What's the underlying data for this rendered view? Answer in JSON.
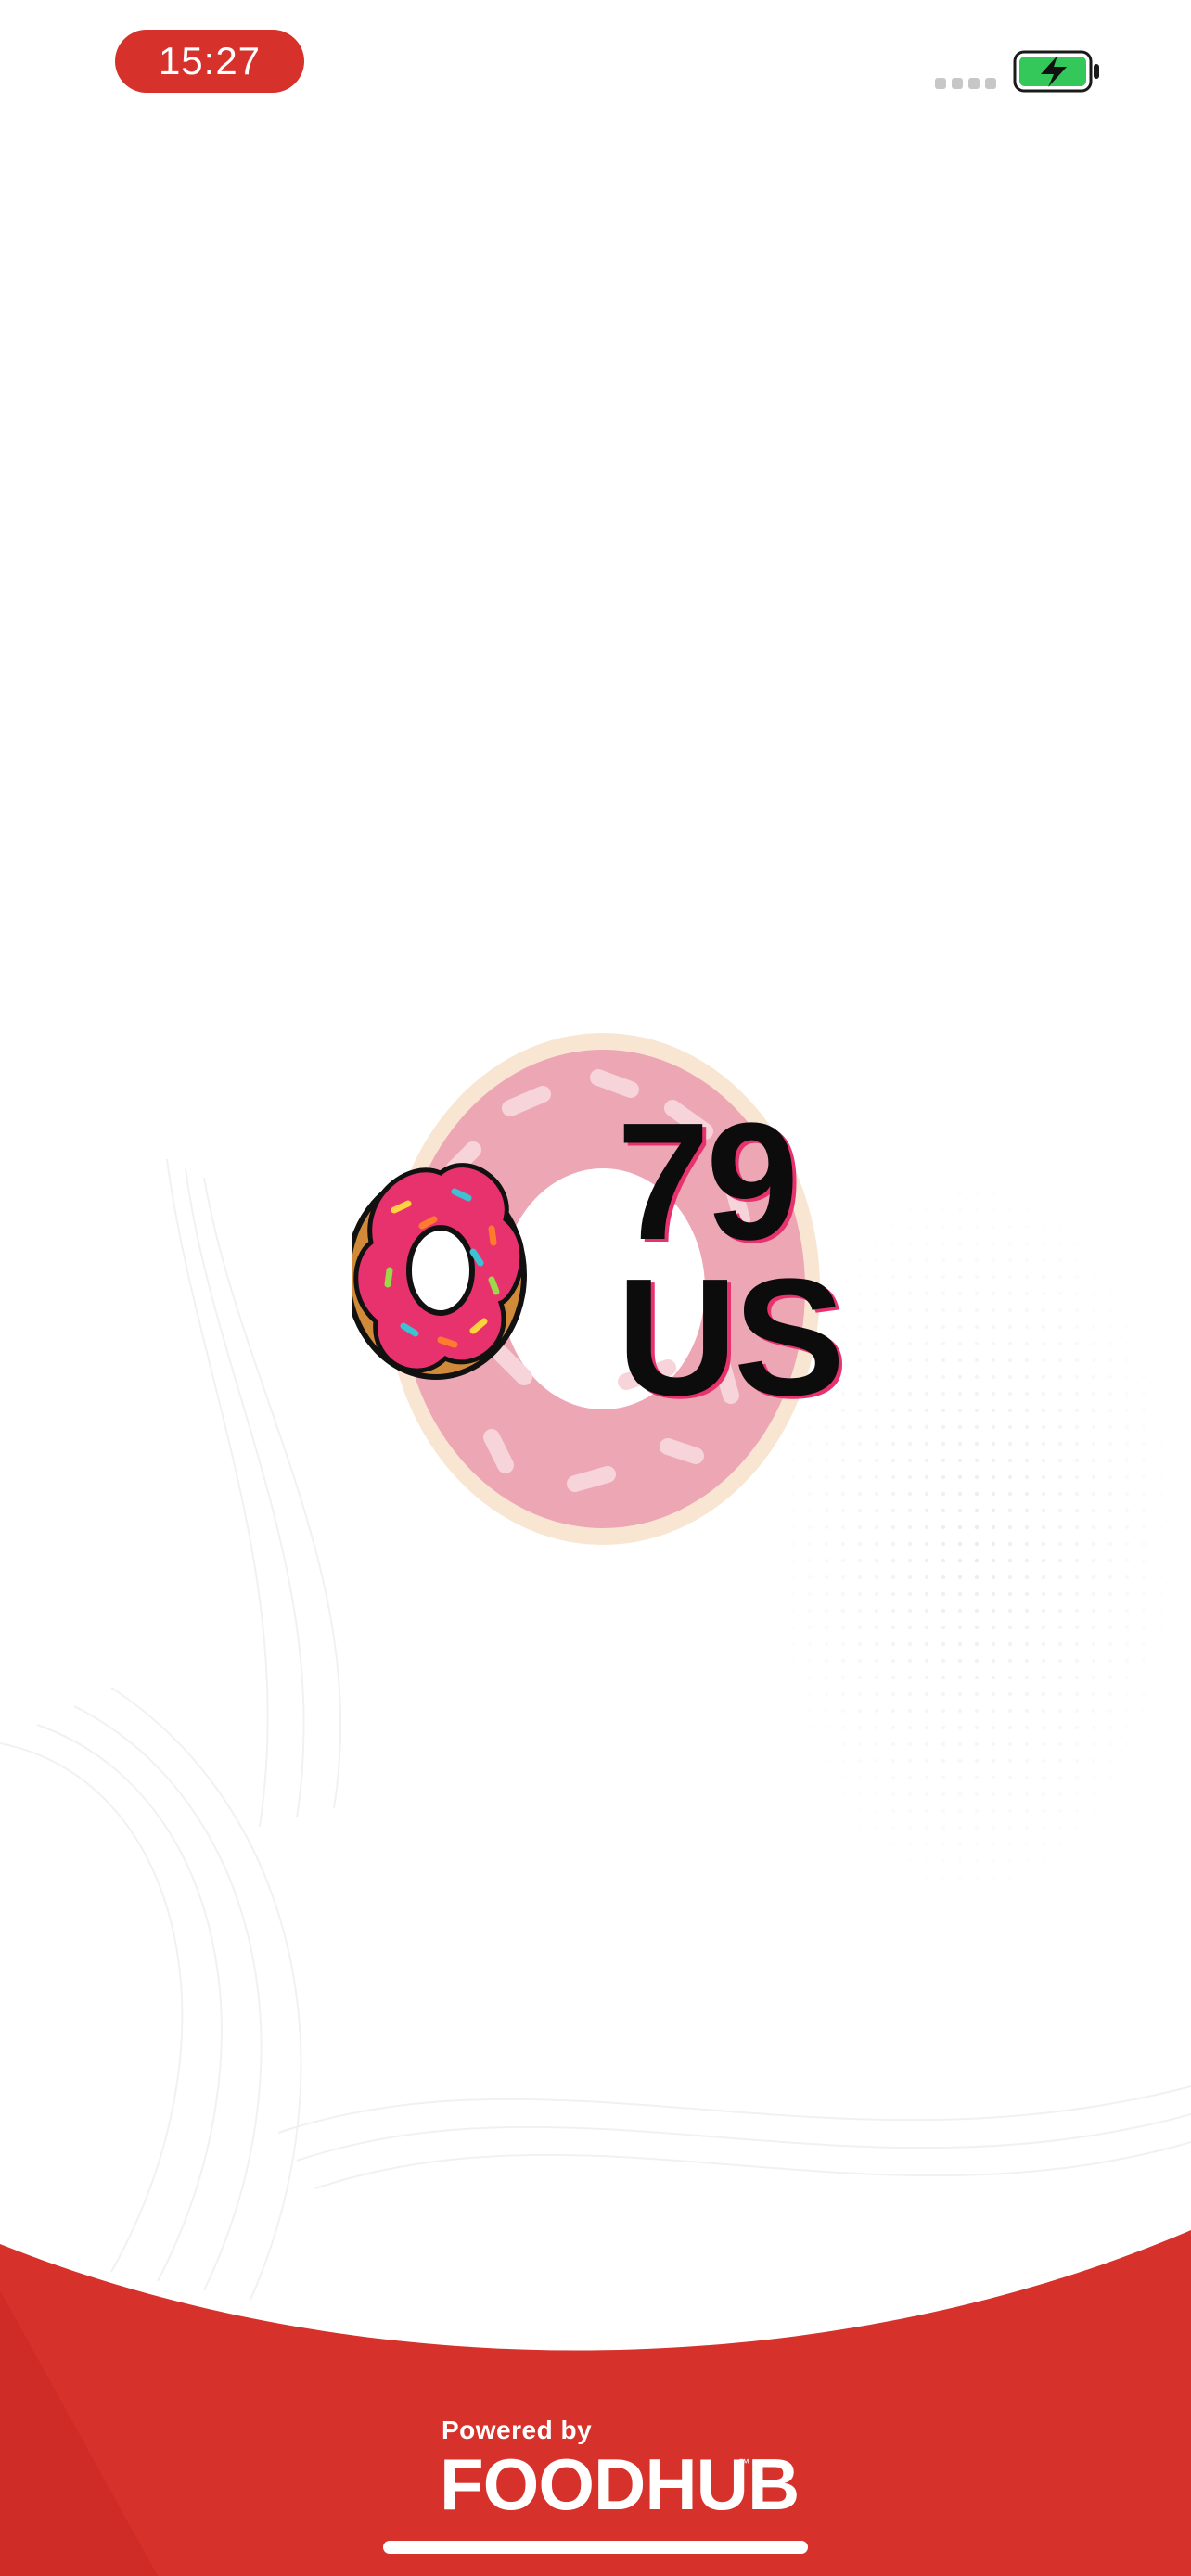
{
  "status_bar": {
    "time": "15:27",
    "signal_icon": "cellular-signal-icon",
    "battery_icon": "battery-charging-icon"
  },
  "logo": {
    "icon": "donut-icon",
    "line_1": "79",
    "line_2": "US"
  },
  "footer": {
    "powered_by": "Powered by",
    "brand": "FOODHUB",
    "trademark": "™"
  },
  "colors": {
    "accent_red": "#d6312b",
    "donut_pink": "#e8326e",
    "donut_ring": "#f4a9bb",
    "battery_green": "#34c759"
  }
}
